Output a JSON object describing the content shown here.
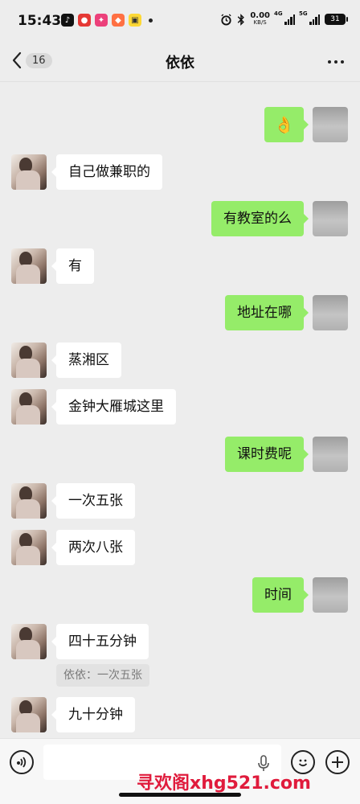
{
  "status_bar": {
    "time": "15:43",
    "network_speed": "0.00",
    "network_unit": "KB/S",
    "sim1": "4G",
    "sim2": "5G",
    "battery": "31"
  },
  "nav": {
    "back_count": "16",
    "title": "依依"
  },
  "messages": [
    {
      "side": "right",
      "text": "👌",
      "kind": "emoji"
    },
    {
      "side": "left",
      "text": "自己做兼职的"
    },
    {
      "side": "right",
      "text": "有教室的么"
    },
    {
      "side": "left",
      "text": "有"
    },
    {
      "side": "right",
      "text": "地址在哪"
    },
    {
      "side": "left",
      "text": "蒸湘区"
    },
    {
      "side": "left",
      "text": "金钟大雁城这里"
    },
    {
      "side": "right",
      "text": "课时费呢"
    },
    {
      "side": "left",
      "text": "一次五张"
    },
    {
      "side": "left",
      "text": "两次八张"
    },
    {
      "side": "right",
      "text": "时间"
    },
    {
      "side": "left",
      "text": "四十五分钟"
    },
    {
      "side": "left",
      "text": "九十分钟"
    }
  ],
  "quote": "依依：一次五张",
  "input": {
    "placeholder": ""
  },
  "watermark": "寻欢阁xhg521.com",
  "colors": {
    "background": "#ededed",
    "bubble_sent": "#95ec69",
    "bubble_received": "#ffffff",
    "watermark": "#e01b3c"
  }
}
